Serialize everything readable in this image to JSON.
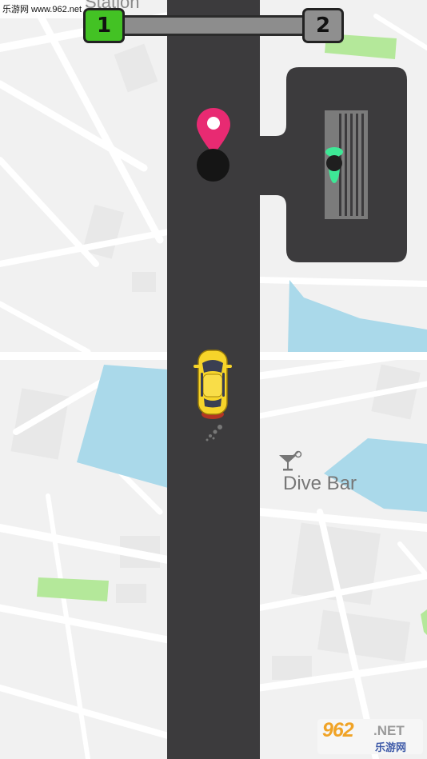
{
  "watermark_top": "乐游网 www.962.net",
  "map": {
    "station_label": "Station",
    "poi": {
      "label": "Dive Bar",
      "icon": "cocktail-icon"
    }
  },
  "progress": {
    "current_level": "1",
    "next_level": "2",
    "fill": 0.0
  },
  "watermark_logo": {
    "main": "962",
    "net": ".NET",
    "sub": "乐游网"
  },
  "colors": {
    "road": "#3c3b3d",
    "map_background": "#f1f1f1",
    "water": "#aad9ea",
    "park": "#b4e89a",
    "progress_active": "#43c224",
    "progress_inactive": "#8f8f8f",
    "pin": "#e82a72",
    "taxi": "#f6d42a",
    "passenger": "#3ee896"
  }
}
